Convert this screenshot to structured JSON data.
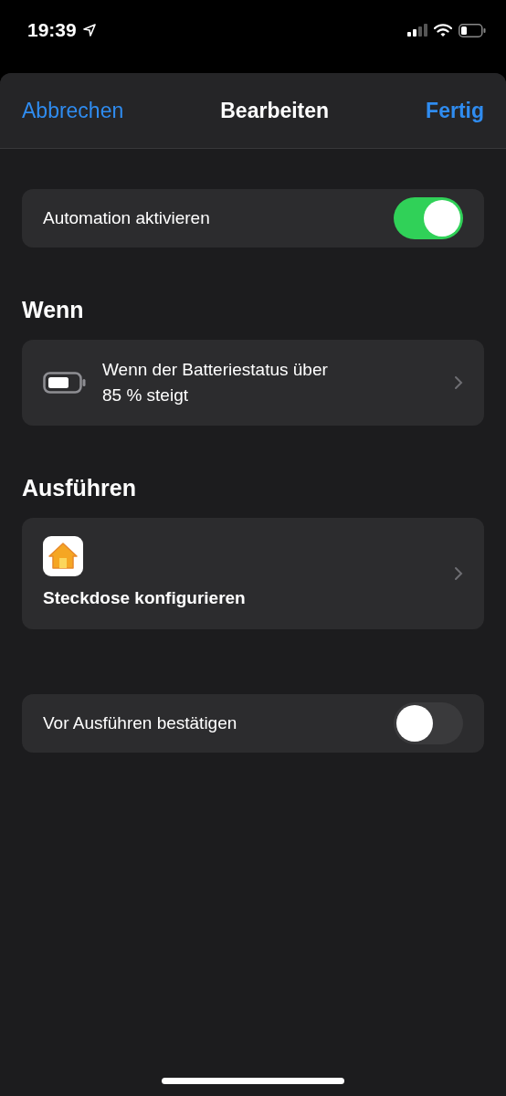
{
  "status_bar": {
    "time": "19:39"
  },
  "nav": {
    "cancel": "Abbrechen",
    "title": "Bearbeiten",
    "done": "Fertig"
  },
  "enable": {
    "label": "Automation aktivieren",
    "on": true
  },
  "sections": [
    {
      "heading": "Wenn",
      "kind": "trigger",
      "text": "Wenn der Batteriestatus über 85 % steigt"
    },
    {
      "heading": "Ausführen",
      "kind": "action",
      "text": "Steckdose konfigurieren"
    }
  ],
  "confirm": {
    "label": "Vor Ausführen bestätigen",
    "on": false
  }
}
